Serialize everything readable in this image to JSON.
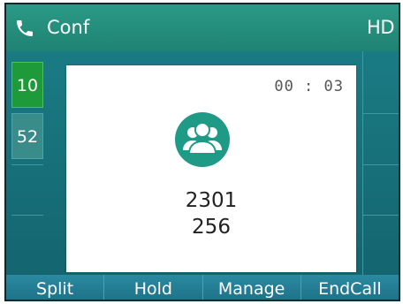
{
  "titlebar": {
    "title": "Conf",
    "hd_label": "HD",
    "title_icon": "phone-icon"
  },
  "line_keys": [
    {
      "label": "10",
      "state": "active"
    },
    {
      "label": "52",
      "state": "inactive"
    }
  ],
  "call": {
    "timer": "00 : 03",
    "icon": "conference-icon",
    "participants": [
      "2301",
      "256"
    ]
  },
  "softkeys": [
    {
      "label": "Split"
    },
    {
      "label": "Hold"
    },
    {
      "label": "Manage"
    },
    {
      "label": "EndCall"
    }
  ],
  "colors": {
    "accent": "#1f8a7a",
    "active_line": "#1f9a3a",
    "icon": "#1e9a86"
  }
}
